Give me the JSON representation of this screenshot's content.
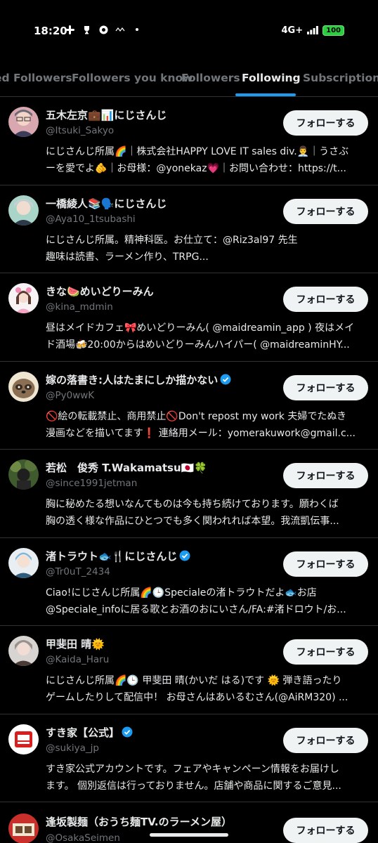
{
  "status_bar": {
    "time": "18:20",
    "network": "4G+",
    "battery": "100"
  },
  "tabs": [
    {
      "label": "ed Followers"
    },
    {
      "label": "Followers you know"
    },
    {
      "label": "Followers"
    },
    {
      "label": "Following"
    },
    {
      "label": "Subscriptions"
    }
  ],
  "follow_label": "フォローする",
  "users": [
    {
      "name": "五木左京💼📊にじさんじ",
      "handle": "@Itsuki_Sakyo",
      "verified": false,
      "bio1": "にじさんじ所属🌈｜株式会社HAPPY LOVE IT sales div.👨‍💼｜うさぶ",
      "bio2": "ーを愛でよ🫵｜お母様：@yonekaz💗｜お問い合わせ：https://t..."
    },
    {
      "name": "一橋綾人📚🗣️にじさんじ",
      "handle": "@Aya10_1tsubashi",
      "verified": false,
      "bio1": "にじさんじ所属。精神科医。お仕立て：@Riz3al97 先生",
      "bio2": "趣味は読書、ラーメン作り、TRPG..."
    },
    {
      "name": "きな🍉めいどりーみん",
      "handle": "@kina_mdmin",
      "verified": false,
      "bio1": "昼はメイドカフェ🎀めいどりーみん( @maidreamin_app ) 夜はメイ",
      "bio2": "ド酒場🍻20:00からはめいどりーみんハイパー( @maidreaminHY..."
    },
    {
      "name": "嫁の落書き:人はたまにしか描かない",
      "handle": "@Py0wwK",
      "verified": true,
      "bio1": "🚫絵の転載禁止、商用禁止🚫Don't repost my work 夫婦でたぬき",
      "bio2": "漫画などを描いてます❗ 連絡用メール：yomerakuwork@gmail.c..."
    },
    {
      "name": "若松　俊秀 T.Wakamatsu🇯🇵🍀",
      "handle": "@since1991jetman",
      "verified": false,
      "bio1": "胸に秘めたる想いなんてものは今も持ち続けております。願わくば",
      "bio2": "胸の透く様な作品にひとつでも多く関われれば本望。我流凱伝事..."
    },
    {
      "name": "渚トラウト🐟🍴にじさんじ",
      "handle": "@Tr0uT_2434",
      "verified": true,
      "bio1": "Ciao!にじさんじ所属🌈🕒Specialeの渚トラウトだよ🐟お店",
      "bio2": "@Speciale_infoに居る歌とお酒のおにいさん/FA:#渚ドロウト/お..."
    },
    {
      "name": "甲斐田 晴🌞",
      "handle": "@Kaida_Haru",
      "verified": false,
      "bio1": "にじさんじ所属🌈🕒 甲斐田 晴(かいだ はる)です 🌞 弾き語ったり",
      "bio2": "ゲームしたりして配信中！ お母さんはあいるむさん(@AiRM320) ..."
    },
    {
      "name": "すき家【公式】",
      "handle": "@sukiya_jp",
      "verified": true,
      "bio1": "すき家公式アカウントです。フェアやキャンペーン情報をお届けし",
      "bio2": "ます。 個別返信は行っておりません。店舗や商品に関するご意見..."
    },
    {
      "name": "逢坂製麺（おうち麺TV.のラーメン屋）",
      "handle": "@OsakaSeimen",
      "verified": false,
      "bio1": "",
      "bio2": ""
    }
  ],
  "colors": {
    "accent": "#1d9bf0",
    "bg": "#000000",
    "muted": "#71767b",
    "button_bg": "#eff3f4"
  }
}
